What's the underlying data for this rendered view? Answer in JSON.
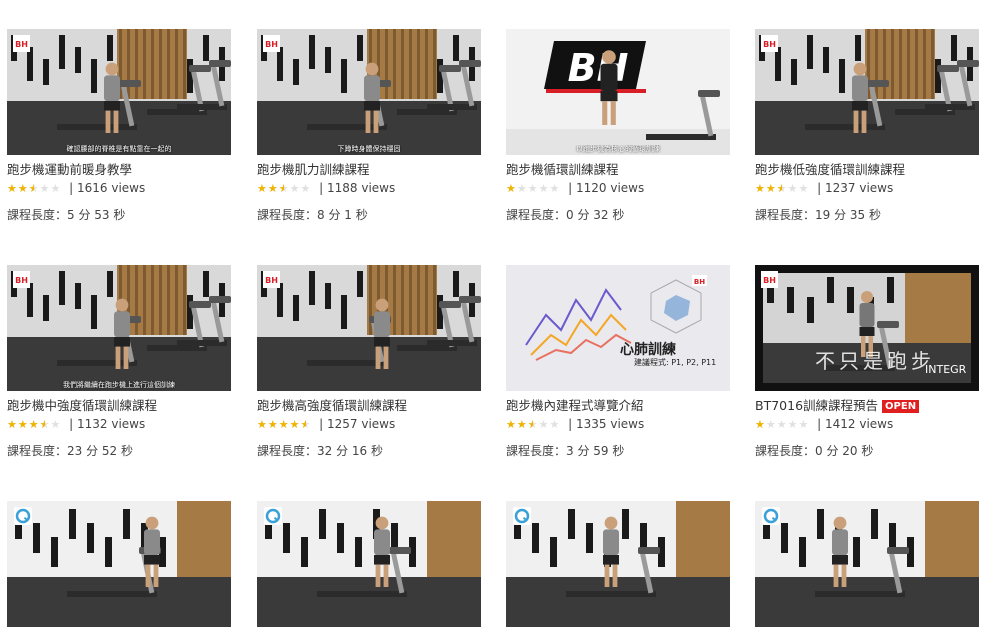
{
  "videos": [
    {
      "title": "跑步機運動前暖身教學",
      "rating": 2.5,
      "views": "| 1616 views",
      "duration": "課程長度：5 分 53 秒",
      "caption": "確認腰部的脊椎是有點靠在一起的",
      "scene": "gym",
      "logo": "BH"
    },
    {
      "title": "跑步機肌力訓練課程",
      "rating": 2.5,
      "views": "| 1188 views",
      "duration": "課程長度：8 分 1 秒",
      "caption": "下蹲時身體保持穩固",
      "scene": "gym",
      "logo": "BH"
    },
    {
      "title": "跑步機循環訓練課程",
      "rating": 1,
      "views": "| 1120 views",
      "duration": "課程長度：0 分 32 秒",
      "caption": "以跑步機為核心的循環訓練",
      "scene": "white",
      "logo": "BH"
    },
    {
      "title": "跑步機低強度循環訓練課程",
      "rating": 2.5,
      "views": "| 1237 views",
      "duration": "課程長度：19 分 35 秒",
      "caption": "",
      "scene": "gym",
      "logo": "BH"
    },
    {
      "title": "跑步機中強度循環訓練課程",
      "rating": 3.5,
      "views": "| 1132 views",
      "duration": "課程長度：23 分 52 秒",
      "caption": "我們將繼續在跑步機上進行這個訓練",
      "scene": "gym",
      "logo": "BH"
    },
    {
      "title": "跑步機高強度循環訓練課程",
      "rating": 4.5,
      "views": "| 1257 views",
      "duration": "課程長度：32 分 16 秒",
      "caption": "",
      "scene": "gym",
      "logo": "BH"
    },
    {
      "title": "跑步機內建程式導覽介紹",
      "rating": 2.5,
      "views": "| 1335 views",
      "duration": "課程長度：3 分 59 秒",
      "caption": "",
      "scene": "chart",
      "logo": "BH",
      "overlay_title": "心肺訓練",
      "overlay_sub": "建議程式: P1, P2, P11"
    },
    {
      "title": "BT7016訓練課程預告",
      "badge": "OPEN",
      "rating": 1,
      "views": "| 1412 views",
      "duration": "課程長度：0 分 20 秒",
      "caption": "",
      "scene": "dark",
      "logo": "BH",
      "overlay_title": "不只是跑步",
      "overlay_sub": "INTEGR"
    },
    {
      "title": "",
      "rating": 0,
      "views": "",
      "duration": "",
      "caption": "",
      "scene": "q",
      "logo": "Q"
    },
    {
      "title": "",
      "rating": 0,
      "views": "",
      "duration": "",
      "caption": "",
      "scene": "q",
      "logo": "Q"
    },
    {
      "title": "",
      "rating": 0,
      "views": "",
      "duration": "",
      "caption": "",
      "scene": "q",
      "logo": "Q"
    },
    {
      "title": "",
      "rating": 0,
      "views": "",
      "duration": "",
      "caption": "",
      "scene": "q",
      "logo": "Q"
    }
  ],
  "colors": {
    "star_on": "#f0b400",
    "star_off": "#e0e0e0",
    "badge": "#e02020",
    "brand_red": "#d81e26"
  }
}
